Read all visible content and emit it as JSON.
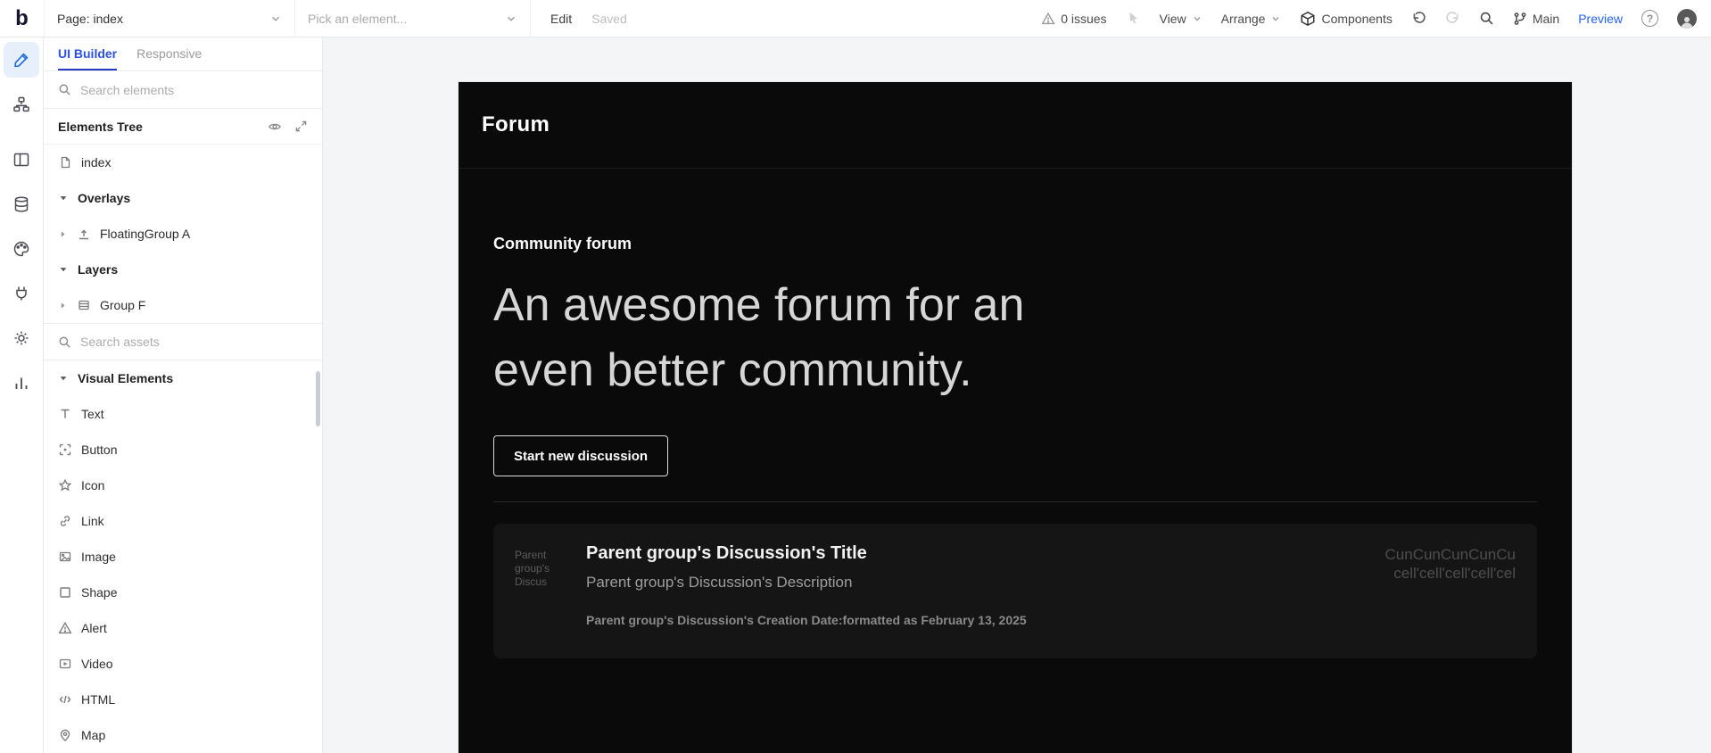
{
  "topbar": {
    "logo": "b",
    "page_label": "Page: index",
    "element_picker_placeholder": "Pick an element...",
    "edit_label": "Edit",
    "saved_label": "Saved",
    "issues_label": "0 issues",
    "view_label": "View",
    "arrange_label": "Arrange",
    "components_label": "Components",
    "branch_label": "Main",
    "preview_label": "Preview",
    "help_label": "?",
    "icons": [
      "warning-icon",
      "cursor-icon",
      "chevron-down-icon",
      "components-cube-icon",
      "undo-icon",
      "redo-icon",
      "search-icon",
      "git-branch-icon",
      "help-icon",
      "avatar"
    ]
  },
  "rail": {
    "icons": [
      "pencil-icon",
      "workflow-icon",
      "layout-icon",
      "database-icon",
      "palette-icon",
      "plugin-icon",
      "gear-icon",
      "chart-icon"
    ],
    "selected": "pencil-icon"
  },
  "panel": {
    "tabs": [
      {
        "label": "UI Builder"
      },
      {
        "label": "Responsive"
      }
    ],
    "search_elements": {
      "placeholder": "Search elements"
    },
    "elements_tree": {
      "title": "Elements Tree"
    },
    "tree": [
      {
        "label": "index"
      },
      {
        "label": "Overlays"
      },
      {
        "label": "FloatingGroup A"
      },
      {
        "label": "Layers"
      },
      {
        "label": "Group F"
      }
    ],
    "search_assets": {
      "placeholder": "Search assets"
    },
    "visual_elements": {
      "title": "Visual Elements",
      "items": [
        "Text",
        "Button",
        "Icon",
        "Link",
        "Image",
        "Shape",
        "Alert",
        "Video",
        "HTML",
        "Map"
      ]
    }
  },
  "canvas": {
    "page": {
      "header_title": "Forum",
      "hero": {
        "kicker": "Community forum",
        "heading": "An awesome forum for an even better community.",
        "cta_label": "Start new discussion"
      },
      "discussion_card": {
        "thumb_text": "Parent group's Discus",
        "title": "Parent group's Discussion's Title",
        "description": "Parent group's Discussion's Description",
        "meta": "Parent group's Discussion's Creation Date:formatted as February 13, 2025",
        "side_text_line1": "CunCunCunCunCu",
        "side_text_line2": "cell'cell'cell'cell'cel"
      }
    }
  },
  "colors": {
    "accent_blue": "#2c50e0",
    "preview_blue": "#2563eb",
    "page_bg": "#0a0a0a",
    "card_bg": "#151515"
  }
}
